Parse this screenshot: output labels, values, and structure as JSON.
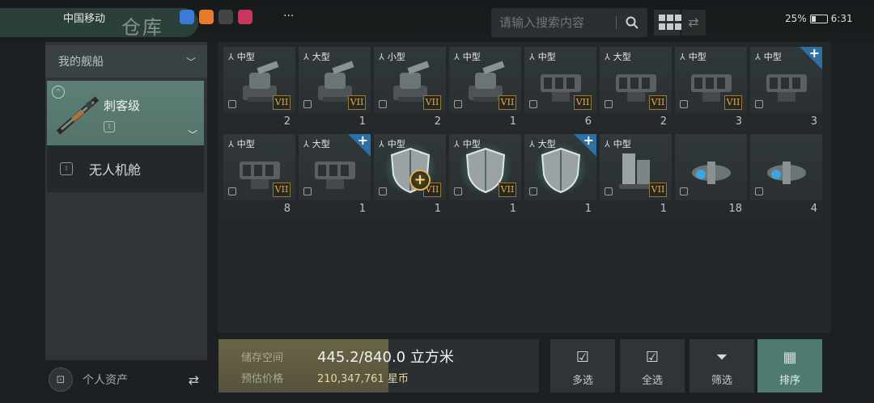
{
  "status_bar": {
    "carrier": "中国移动",
    "time": "6:31",
    "battery": "25%",
    "more": "···"
  },
  "header": {
    "back_icon": "menu-lines-icon",
    "title": "仓库",
    "search": {
      "placeholder": "请输入搜索内容"
    }
  },
  "sidebar": {
    "section_title": "我的舰船",
    "ship": {
      "name": "刺客级"
    },
    "drone_bay": {
      "label": "无人机舱"
    },
    "personal_assets": {
      "label": "个人资产"
    }
  },
  "items": [
    {
      "size": "中型",
      "icon": "turret",
      "tier": "VII",
      "count": "2"
    },
    {
      "size": "大型",
      "icon": "turret",
      "tier": "VII",
      "count": "1"
    },
    {
      "size": "小型",
      "icon": "turret",
      "tier": "VII",
      "count": "2"
    },
    {
      "size": "中型",
      "icon": "turret",
      "tier": "VII",
      "count": "1"
    },
    {
      "size": "中型",
      "icon": "launcher",
      "tier": "VII",
      "count": "6"
    },
    {
      "size": "大型",
      "icon": "launcher",
      "tier": "VII",
      "count": "2"
    },
    {
      "size": "中型",
      "icon": "launcher",
      "tier": "VII",
      "count": "3"
    },
    {
      "size": "中型",
      "icon": "launcher",
      "tier": "",
      "count": "3",
      "plus": "+"
    },
    {
      "size": "中型",
      "icon": "launcher",
      "tier": "VII",
      "count": "8"
    },
    {
      "size": "大型",
      "icon": "launcher",
      "tier": "",
      "count": "1",
      "plus": "+"
    },
    {
      "size": "中型",
      "icon": "shield",
      "tier": "VII",
      "count": "1"
    },
    {
      "size": "中型",
      "icon": "shield",
      "tier": "VII",
      "count": "1"
    },
    {
      "size": "大型",
      "icon": "shield",
      "tier": "",
      "count": "1",
      "plus": "+"
    },
    {
      "size": "中型",
      "icon": "module",
      "tier": "VII",
      "count": "1"
    },
    {
      "size": "",
      "icon": "drone",
      "tier": "",
      "count": "18"
    },
    {
      "size": "",
      "icon": "drone",
      "tier": "",
      "count": "4"
    }
  ],
  "storage": {
    "space_label": "储存空间",
    "space_value": "445.2/840.0 立方米",
    "fill_fraction": 0.53,
    "price_label": "预估价格",
    "price_value": "210,347,761 星币"
  },
  "actions": {
    "multi_select": "多选",
    "select_all": "全选",
    "filter": "筛选",
    "sort": "排序"
  },
  "colors": {
    "accent": "#4e7a70",
    "tier_gold": "#cfb16f",
    "corner_blue": "#2f6fa2"
  }
}
